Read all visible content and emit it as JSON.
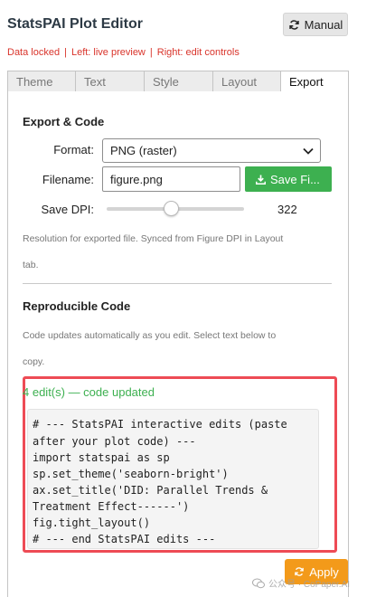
{
  "app": {
    "title": "StatsPAI Plot Editor",
    "manual_label": "Manual"
  },
  "status": {
    "data_locked": "Data locked",
    "left": "Left: live preview",
    "right": "Right: edit controls",
    "separator": "|"
  },
  "tabs": [
    {
      "label": "Theme",
      "active": false
    },
    {
      "label": "Text",
      "active": false
    },
    {
      "label": "Style",
      "active": false
    },
    {
      "label": "Layout",
      "active": false
    },
    {
      "label": "Export",
      "active": true
    }
  ],
  "export": {
    "heading": "Export & Code",
    "format_label": "Format:",
    "format_value": "PNG (raster)",
    "filename_label": "Filename:",
    "filename_value": "figure.png",
    "save_label": "Save Fi...",
    "dpi_label": "Save DPI:",
    "dpi_value": "322",
    "dpi_fraction": 0.47,
    "hint_line1": "Resolution for exported file. Synced from Figure DPI in Layout",
    "hint_line2": "tab."
  },
  "code": {
    "heading": "Reproducible Code",
    "hint_line1": "Code updates automatically as you edit. Select text below to",
    "hint_line2": "copy.",
    "edit_status": "4 edit(s) — code updated",
    "lines": [
      "# --- StatsPAI interactive edits (paste",
      "after your plot code) ---",
      "import statspai as sp",
      "sp.set_theme('seaborn-bright')",
      "ax.set_title('DID: Parallel Trends &",
      "Treatment Effect------')",
      "fig.tight_layout()",
      "# --- end StatsPAI edits ---"
    ]
  },
  "footer": {
    "apply_label": "Apply",
    "watermark_text": "公众号 · CoPaper.AI"
  },
  "colors": {
    "accent_red": "#d9342b",
    "save_green": "#3db050",
    "apply_orange": "#f39a1a",
    "highlight_red": "#ee4b55"
  }
}
